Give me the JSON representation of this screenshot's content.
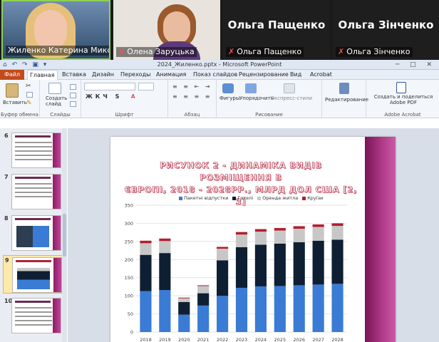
{
  "participants": [
    {
      "name": "Жиленко Катерина Мико...",
      "muted": false
    },
    {
      "name": "Олена Заруцька",
      "muted": true
    },
    {
      "name": "Ольга Пащенко",
      "muted": true,
      "big_name": "Ольга Пащенко"
    },
    {
      "name": "Ольга Зінченко",
      "muted": true,
      "big_name": "Ольга Зінченко"
    }
  ],
  "window": {
    "title": "2024_Жиленко.pptx  -  Microsoft PowerPoint",
    "quick_access": "⌂ ↶ ↷ ▣ ▾",
    "window_controls": "─ □ ✕"
  },
  "ribbon_tabs": [
    "Файл",
    "Главная",
    "Вставка",
    "Дизайн",
    "Переходы",
    "Анимация",
    "Показ слайдов",
    "Рецензирование",
    "Вид",
    "Acrobat"
  ],
  "active_tab": "Главная",
  "ribbon": {
    "paste": "Вставить",
    "clipboard": "Буфер обмена",
    "new_slide": "Создать слайд",
    "slides": "Слайды",
    "font": "Шрифт",
    "paragraph": "Абзац",
    "shapes": "Фигуры",
    "arrange": "Упорядочить",
    "quick_styles": "Экспресс-стили",
    "drawing": "Рисование",
    "editing": "Редактирование",
    "create_pdf": "Создать и поделиться Adobe PDF",
    "acrobat": "Adobe Acrobat"
  },
  "thumbnails": [
    {
      "number": "6",
      "selected": false
    },
    {
      "number": "7",
      "selected": false
    },
    {
      "number": "8",
      "selected": false
    },
    {
      "number": "9",
      "selected": true
    },
    {
      "number": "10",
      "selected": false
    }
  ],
  "slide": {
    "title_line1": "РИСУНОК 2 - ДИНАМІКА ВИДІВ РОЗМІЩЕННЯ В",
    "title_line2": "ЄВРОПІ, 2018 - 2028РР., МЛРД ДОЛ США [2, 3]"
  },
  "chart_data": {
    "type": "bar",
    "stacked": true,
    "categories": [
      "2018",
      "2019",
      "2020",
      "2021",
      "2022",
      "2023",
      "2024",
      "2025",
      "2026",
      "2027",
      "2028"
    ],
    "series": [
      {
        "name": "Пакетні відпустки",
        "color": "#3a7bd5",
        "values": [
          113,
          116,
          48,
          73,
          100,
          122,
          126,
          127,
          129,
          131,
          133
        ]
      },
      {
        "name": "Готелі",
        "color": "#0f1f33",
        "values": [
          100,
          102,
          35,
          34,
          98,
          112,
          115,
          117,
          119,
          121,
          122
        ]
      },
      {
        "name": "Оренда житла",
        "color": "#c7c7c7",
        "values": [
          32,
          33,
          10,
          20,
          32,
          35,
          36,
          36,
          37,
          38,
          38
        ]
      },
      {
        "name": "Круїзи",
        "color": "#b31e2b",
        "values": [
          7,
          7,
          2,
          2,
          5,
          7,
          7,
          7,
          7,
          7,
          7
        ]
      }
    ],
    "ylim": [
      0,
      350
    ],
    "yticks": [
      0,
      50,
      100,
      150,
      200,
      250,
      300,
      350
    ],
    "grid": true,
    "legend": "top"
  }
}
